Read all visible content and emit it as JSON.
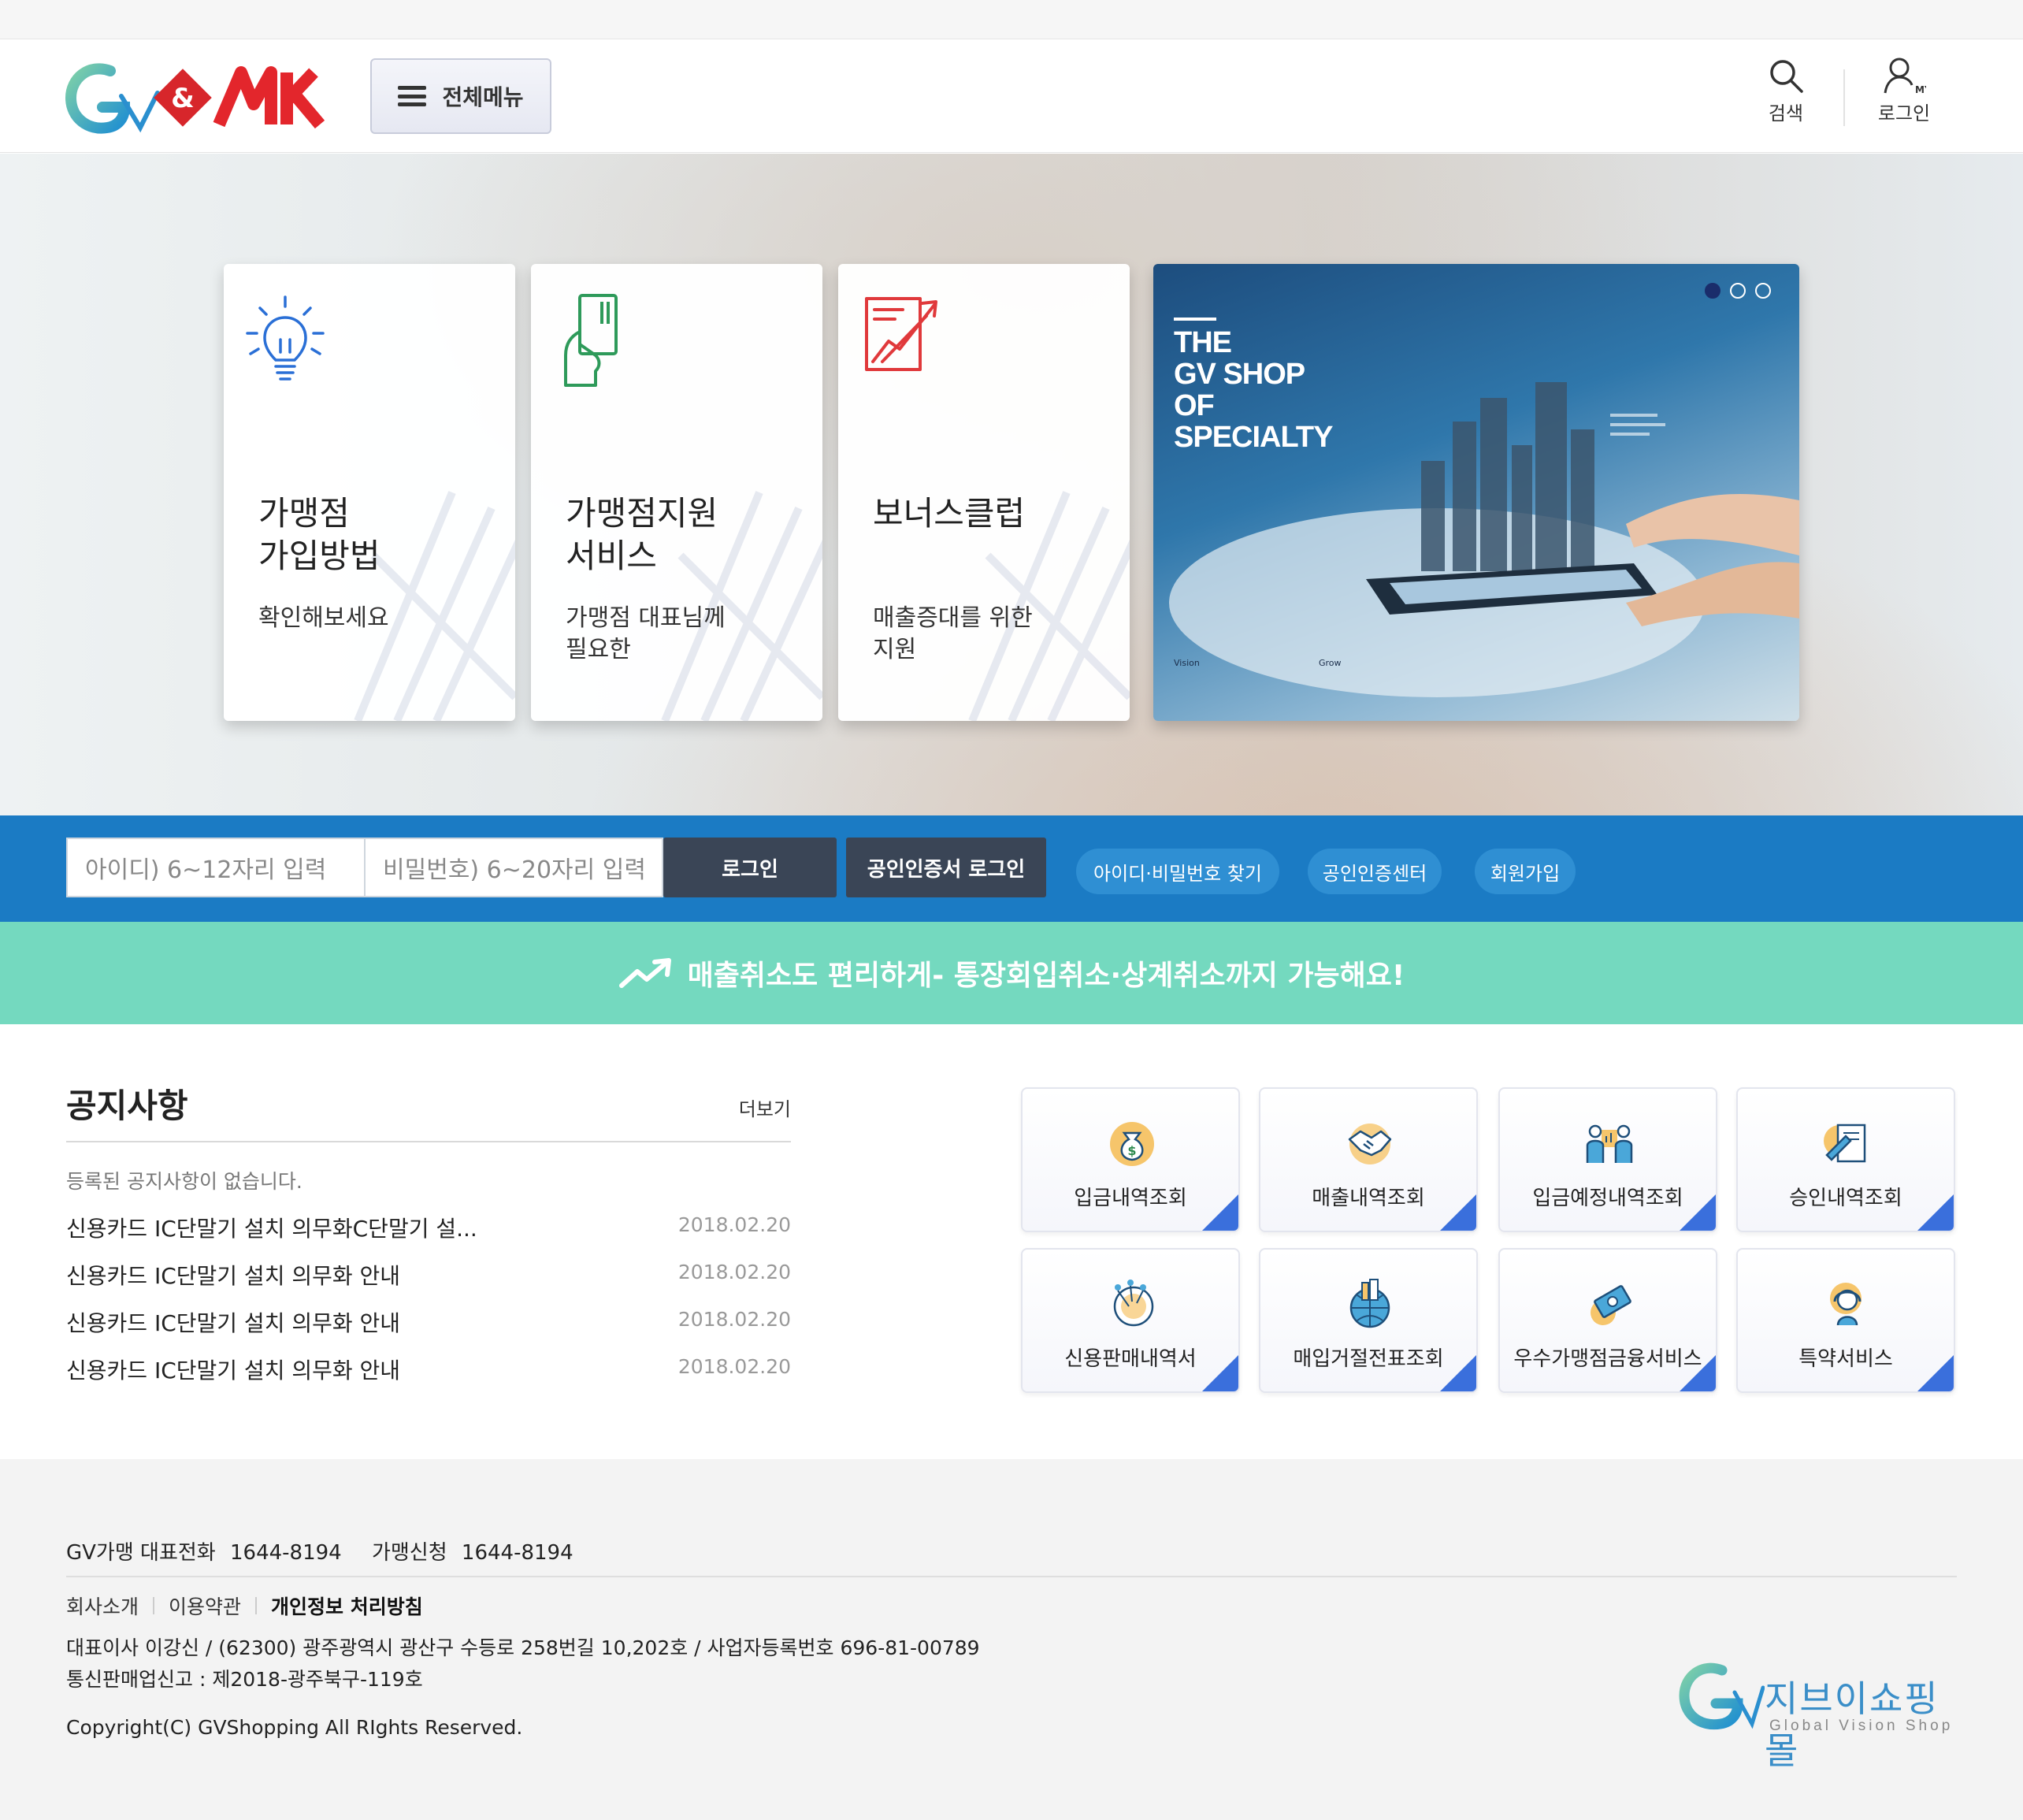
{
  "header": {
    "brand": "GV & MK",
    "menu_label": "전체메뉴",
    "search_label": "검색",
    "login_label": "로그인",
    "login_badge": "MY"
  },
  "hero": {
    "cards": [
      {
        "title": "가맹점\n가입방법",
        "subtitle": "확인해보세요",
        "icon": "lightbulb-icon",
        "color": "#2a6fd6"
      },
      {
        "title": "가맹점지원\n서비스",
        "subtitle": "가맹점 대표님께\n필요한",
        "icon": "card-hand-icon",
        "color": "#2e9a5a"
      },
      {
        "title": "보너스클럽",
        "subtitle": "매출증대를 위한\n지원",
        "icon": "chart-document-icon",
        "color": "#e0393b"
      }
    ],
    "banner": {
      "text": "THE\nGV SHOP\nOF\nSPECIALTY",
      "small_left": "Vision",
      "small_right": "Grow",
      "active_slide": 1,
      "slide_count": 3
    }
  },
  "login_bar": {
    "id_placeholder": "아이디) 6~12자리 입력",
    "pw_placeholder": "비밀번호) 6~20자리 입력",
    "login_button": "로그인",
    "cert_login_button": "공인인증서 로그인",
    "links": [
      "아이디·비밀번호 찾기",
      "공인인증센터",
      "회원가입"
    ]
  },
  "promo": {
    "text": "매출취소도 편리하게- 통장회입취소·상계취소까지 가능해요!"
  },
  "notice": {
    "title": "공지사항",
    "more": "더보기",
    "empty": "등록된 공지사항이 없습니다.",
    "items": [
      {
        "title": "신용카드 IC단말기 설치 의무화C단말기 설...",
        "date": "2018.02.20"
      },
      {
        "title": "신용카드 IC단말기 설치 의무화 안내",
        "date": "2018.02.20"
      },
      {
        "title": "신용카드 IC단말기 설치 의무화 안내",
        "date": "2018.02.20"
      },
      {
        "title": "신용카드 IC단말기 설치 의무화 안내",
        "date": "2018.02.20"
      }
    ]
  },
  "quick_menu": [
    {
      "label": "입금내역조회",
      "icon": "money-bag-icon"
    },
    {
      "label": "매출내역조회",
      "icon": "handshake-icon"
    },
    {
      "label": "입금예정내역조회",
      "icon": "people-chart-icon"
    },
    {
      "label": "승인내역조회",
      "icon": "document-pen-icon"
    },
    {
      "label": "신용판매내역서",
      "icon": "network-globe-icon"
    },
    {
      "label": "매입거절전표조회",
      "icon": "city-globe-icon"
    },
    {
      "label": "우수가맹점금융서비스",
      "icon": "banknote-icon"
    },
    {
      "label": "특약서비스",
      "icon": "support-agent-icon"
    }
  ],
  "footer": {
    "phone_label": "GV가맹 대표전화",
    "phone": "1644-8194",
    "apply_label": "가맹신청",
    "apply_phone": "1644-8194",
    "links": [
      "회사소개",
      "이용약관",
      "개인정보 처리방침"
    ],
    "address": "대표이사 이강신 / (62300) 광주광역시 광산구 수등로 258번길 10,202호 / 사업자등록번호 696-81-00789\n통신판매업신고 : 제2018-광주북구-119호",
    "copyright": "Copyright(C) GVShopping All RIghts Reserved.",
    "logo_kr": "지브이쇼핑몰",
    "logo_en": "Global Vision Shop"
  },
  "colors": {
    "login_bar": "#1b7bc4",
    "promo_bar": "#74d9bf",
    "button_dark": "#3a4556",
    "tile_accent": "#3a6fdc"
  }
}
